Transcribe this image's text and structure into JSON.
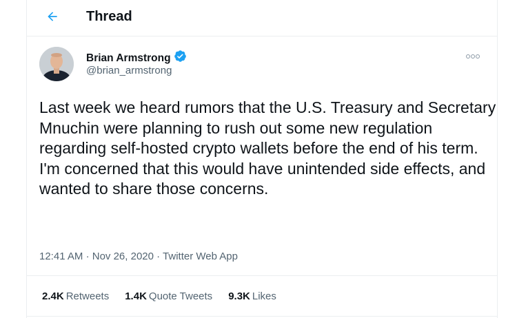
{
  "header": {
    "back_icon": "arrow-left-icon",
    "title": "Thread",
    "accent_color": "#1da1f2"
  },
  "tweet": {
    "author": {
      "name": "Brian Armstrong",
      "handle": "@brian_armstrong",
      "verified_icon": "verified-badge-icon",
      "avatar_icon": "avatar"
    },
    "more_icon": "more-options-icon",
    "text": "Last week we heard rumors that the U.S. Treasury and Secretary Mnuchin were planning to rush out some new regulation regarding self-hosted crypto wallets before the end of his term. I'm concerned that this would have unintended side effects, and wanted to share those concerns.",
    "time": "12:41 AM",
    "separator": "·",
    "date": "Nov 26, 2020",
    "source": "Twitter Web App"
  },
  "stats": {
    "retweets_count": "2.4K",
    "retweets_label": "Retweets",
    "quotes_count": "1.4K",
    "quotes_label": "Quote Tweets",
    "likes_count": "9.3K",
    "likes_label": "Likes"
  }
}
